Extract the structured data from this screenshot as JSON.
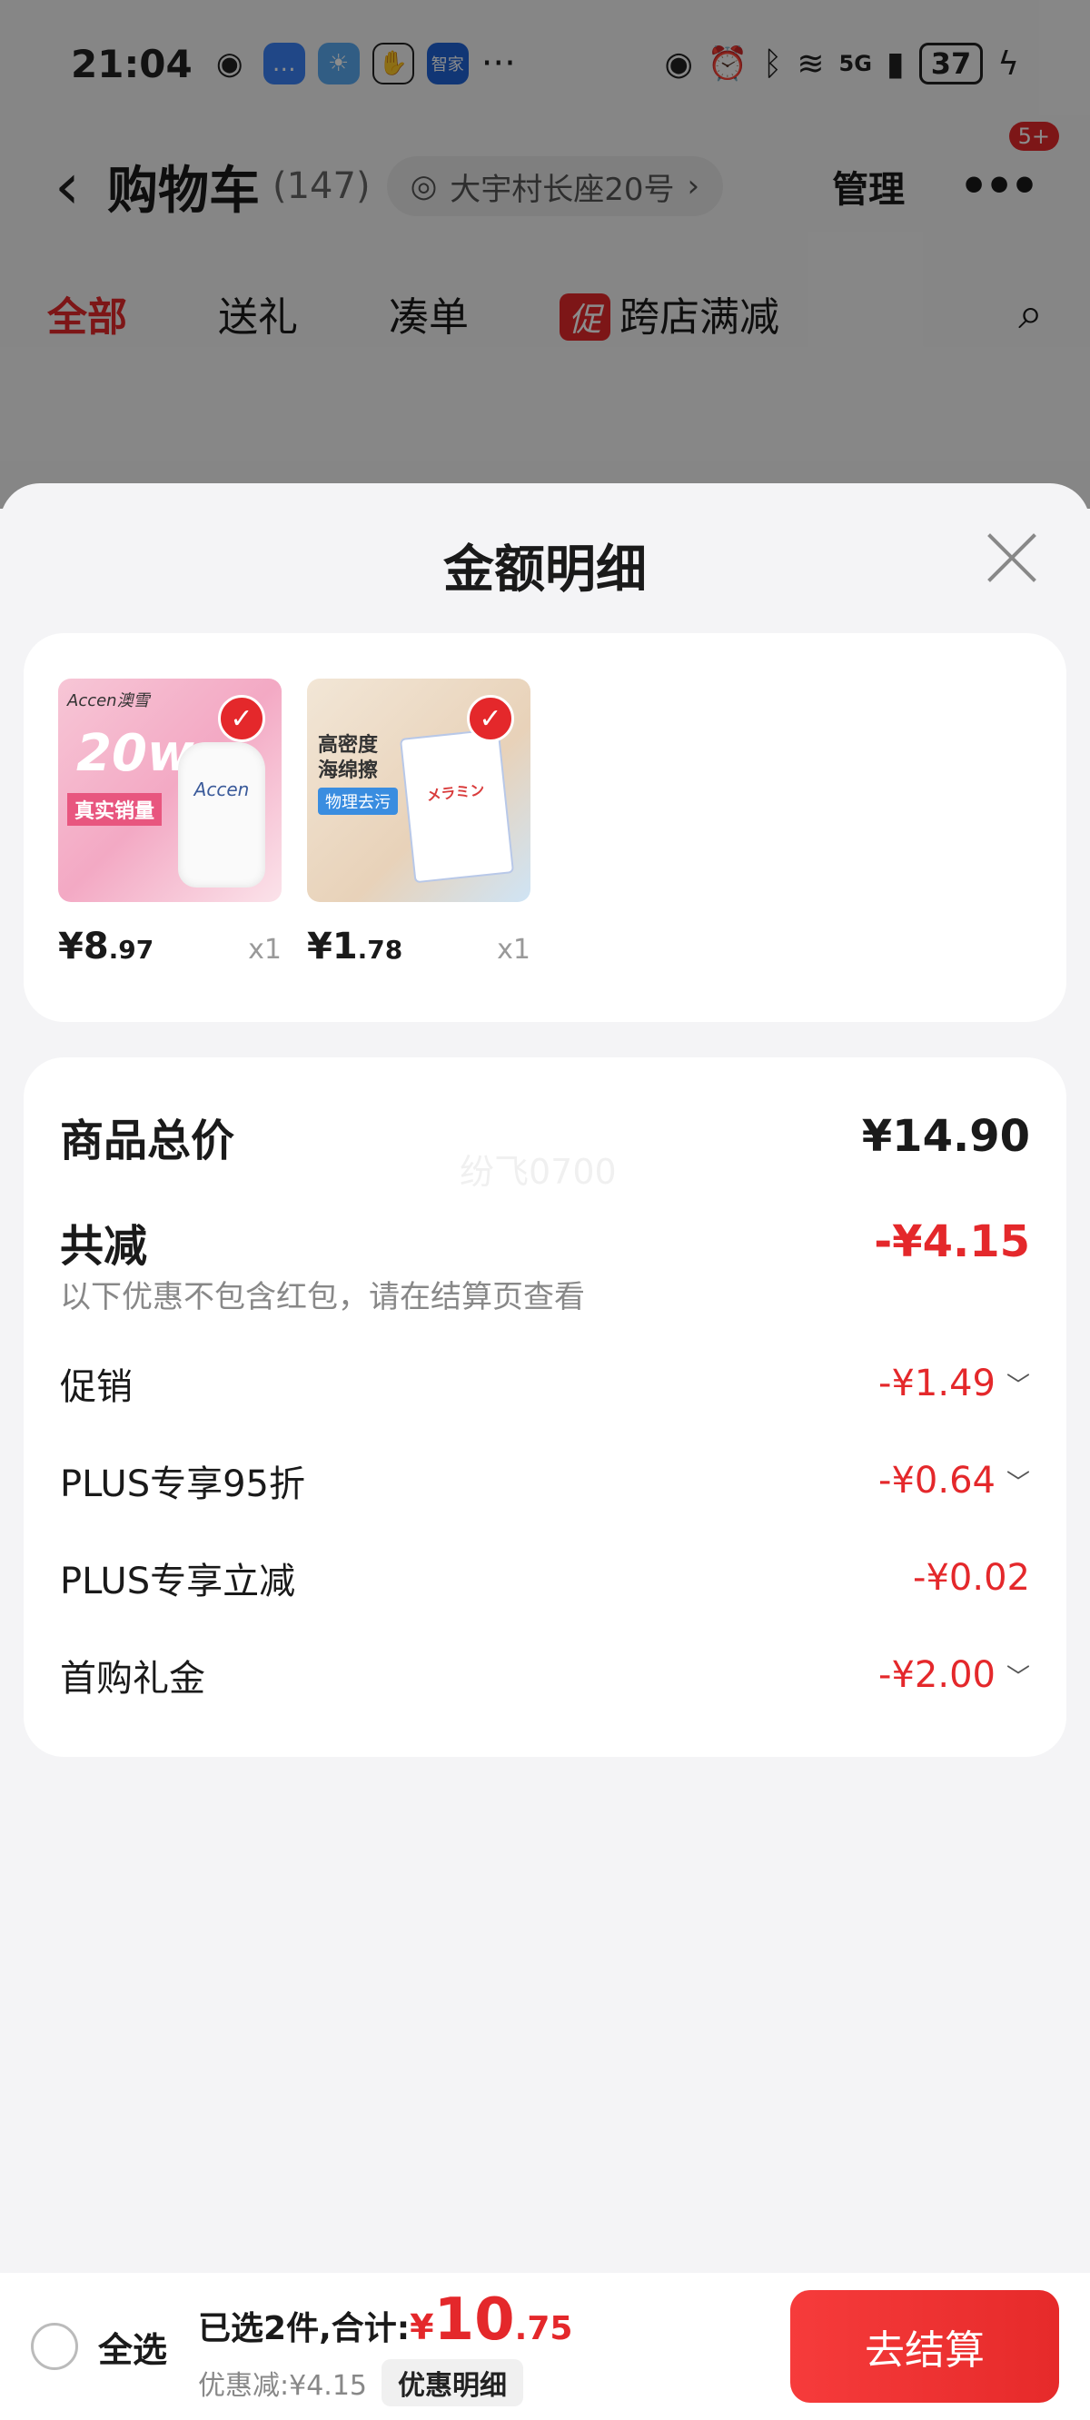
{
  "status_bar": {
    "time": "21:04",
    "app_icons": [
      "wechat-icon",
      "message-icon",
      "weather-icon",
      "hand-icon"
    ],
    "smart_home_label": "智家",
    "more": "···",
    "network": "5G",
    "battery": "37"
  },
  "nav": {
    "title": "购物车",
    "count": "(147)",
    "address": "大宇村长座20号",
    "manage": "管理",
    "more_badge": "5+"
  },
  "tabs": [
    {
      "label": "全部",
      "active": true
    },
    {
      "label": "送礼",
      "active": false
    },
    {
      "label": "凑单",
      "active": false
    },
    {
      "label": "跨店满减",
      "tag": "促",
      "active": false
    }
  ],
  "sheet": {
    "title": "金额明细",
    "products": [
      {
        "price_int": "¥8",
        "price_dec": ".97",
        "qty": "x1",
        "brand": "Accen澳雪",
        "badge_text": "20w",
        "sales_text": "真实销量"
      },
      {
        "price_int": "¥1",
        "price_dec": ".78",
        "qty": "x1",
        "text1": "高密度\n海绵擦",
        "text2": "物理去污"
      }
    ],
    "summary": {
      "total_label": "商品总价",
      "total_value": "¥14.90",
      "reduction_label": "共减",
      "reduction_value": "-¥4.15",
      "note": "以下优惠不包含红包，请在结算页查看",
      "watermark": "纷飞0700",
      "items": [
        {
          "label": "促销",
          "value": "-¥1.49",
          "expandable": true
        },
        {
          "label": "PLUS专享95折",
          "value": "-¥0.64",
          "expandable": true
        },
        {
          "label": "PLUS专享立减",
          "value": "-¥0.02",
          "expandable": false
        },
        {
          "label": "首购礼金",
          "value": "-¥2.00",
          "expandable": true
        }
      ]
    }
  },
  "bottom_bar": {
    "select_all": "全选",
    "selected_text": "已选2件,合计:",
    "total_currency": "¥",
    "total_int": "10",
    "total_dec": ".75",
    "discount_text": "优惠减:¥4.15",
    "detail_button": "优惠明细",
    "checkout_button": "去结算"
  }
}
